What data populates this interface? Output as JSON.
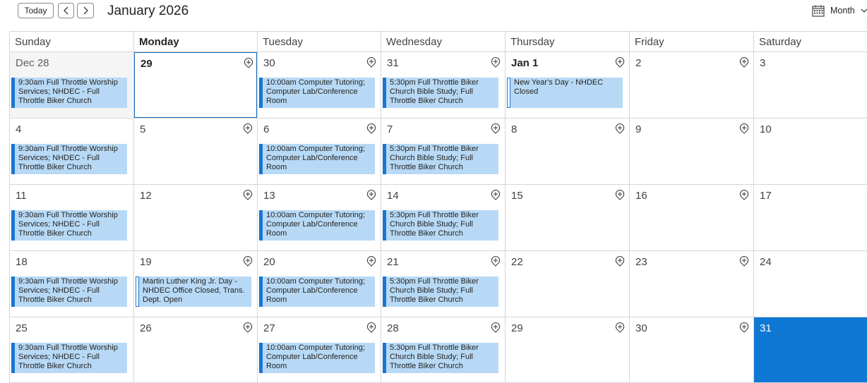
{
  "toolbar": {
    "today_label": "Today",
    "prev_icon": "chevron-left-icon",
    "next_icon": "chevron-right-icon",
    "title": "January 2026",
    "view_label": "Month",
    "view_icon": "calendar-grid-icon"
  },
  "colors": {
    "event_fill": "#b7d9f5",
    "event_bar": "#1a75cf",
    "selected_day": "#0f78d4",
    "today_border": "#0f6cbd"
  },
  "weekdays": [
    "Sunday",
    "Monday",
    "Tuesday",
    "Wednesday",
    "Thursday",
    "Friday",
    "Saturday"
  ],
  "weeks": [
    {
      "days": [
        {
          "label": "Dec 28",
          "other_month": true
        },
        {
          "label": "29",
          "today": true
        },
        {
          "label": "30"
        },
        {
          "label": "31"
        },
        {
          "label": "Jan 1",
          "bold": true
        },
        {
          "label": "2"
        },
        {
          "label": "3"
        }
      ]
    },
    {
      "days": [
        {
          "label": "4"
        },
        {
          "label": "5"
        },
        {
          "label": "6"
        },
        {
          "label": "7"
        },
        {
          "label": "8"
        },
        {
          "label": "9"
        },
        {
          "label": "10"
        }
      ]
    },
    {
      "days": [
        {
          "label": "11"
        },
        {
          "label": "12"
        },
        {
          "label": "13"
        },
        {
          "label": "14"
        },
        {
          "label": "15"
        },
        {
          "label": "16"
        },
        {
          "label": "17"
        }
      ]
    },
    {
      "days": [
        {
          "label": "18"
        },
        {
          "label": "19"
        },
        {
          "label": "20"
        },
        {
          "label": "21"
        },
        {
          "label": "22"
        },
        {
          "label": "23"
        },
        {
          "label": "24"
        }
      ]
    },
    {
      "days": [
        {
          "label": "25"
        },
        {
          "label": "26"
        },
        {
          "label": "27"
        },
        {
          "label": "28"
        },
        {
          "label": "29"
        },
        {
          "label": "30"
        },
        {
          "label": "31",
          "selected": true
        }
      ]
    }
  ],
  "events": {
    "sunday_worship": "9:30am Full Throttle Worship Services; NHDEC - Full Throttle Biker Church",
    "tuesday_tutoring": "10:00am Computer Tutoring; Computer Lab/Conference Room",
    "wednesday_bible": "5:30pm Full Throttle Biker Church Bible Study; Full Throttle Biker Church",
    "new_years": "New Year's Day - NHDEC Closed",
    "mlk_day": "Martin Luther King Jr. Day - NHDEC Office Closed, Trans. Dept. Open"
  }
}
